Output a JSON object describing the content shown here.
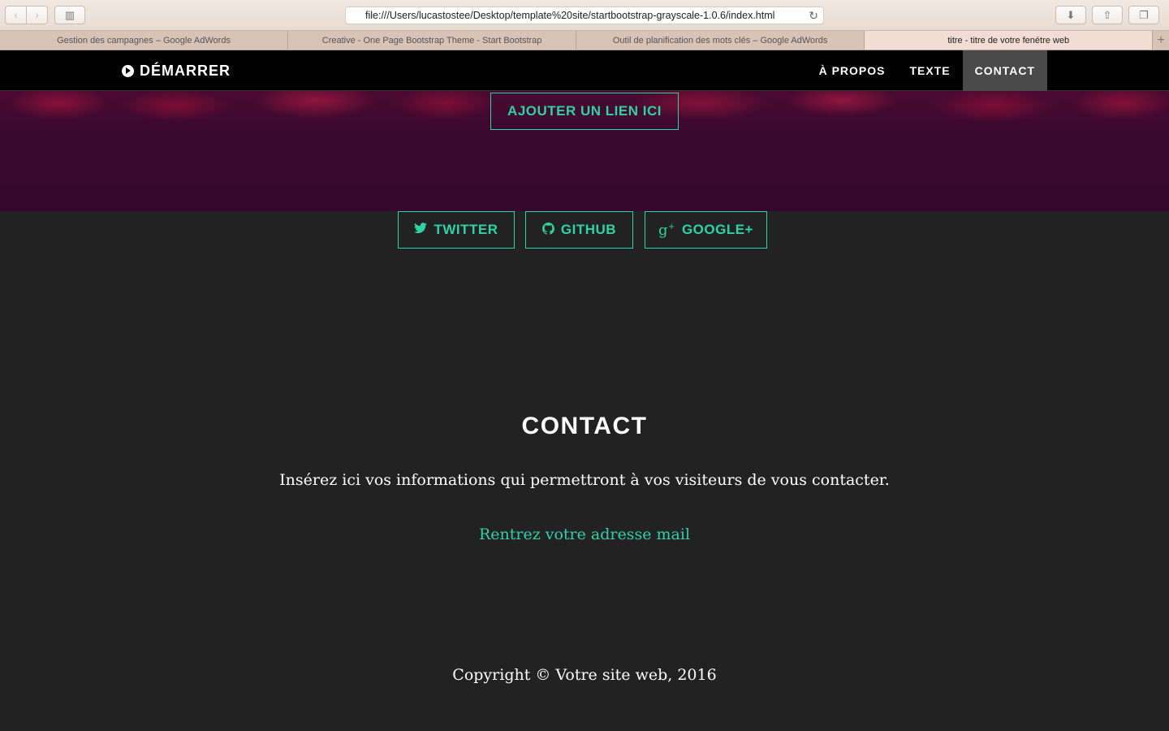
{
  "browser": {
    "url": "file:///Users/lucastostee/Desktop/template%20site/startbootstrap-grayscale-1.0.6/index.html",
    "tabs": [
      {
        "label": "Gestion des campagnes – Google AdWords"
      },
      {
        "label": "Creative - One Page Bootstrap Theme - Start Bootstrap"
      },
      {
        "label": "Outil de planification des mots clés – Google AdWords"
      },
      {
        "label": "titre - titre de votre fenétre web"
      }
    ],
    "new_tab_label": "+"
  },
  "navbar": {
    "brand": "DÉMARRER",
    "links": [
      {
        "label": "À PROPOS"
      },
      {
        "label": "TEXTE"
      },
      {
        "label": "CONTACT"
      }
    ]
  },
  "hero": {
    "button_label": "AJOUTER UN LIEN ICI"
  },
  "contact": {
    "title": "CONTACT",
    "text": "Insérez ici vos informations qui permettront à vos visiteurs de vous contacter.",
    "email_link": "Rentrez votre adresse mail",
    "social": [
      {
        "label": "TWITTER",
        "icon": "twitter-icon"
      },
      {
        "label": "GITHUB",
        "icon": "github-icon"
      },
      {
        "label": "GOOGLE+",
        "icon": "google-plus-icon"
      }
    ],
    "copyright": "Copyright © Votre site web, 2016"
  },
  "colors": {
    "accent": "#2fd3a3",
    "navbar_bg": "#000000",
    "section_bg": "#222222",
    "hero_bg": "#36072c"
  }
}
